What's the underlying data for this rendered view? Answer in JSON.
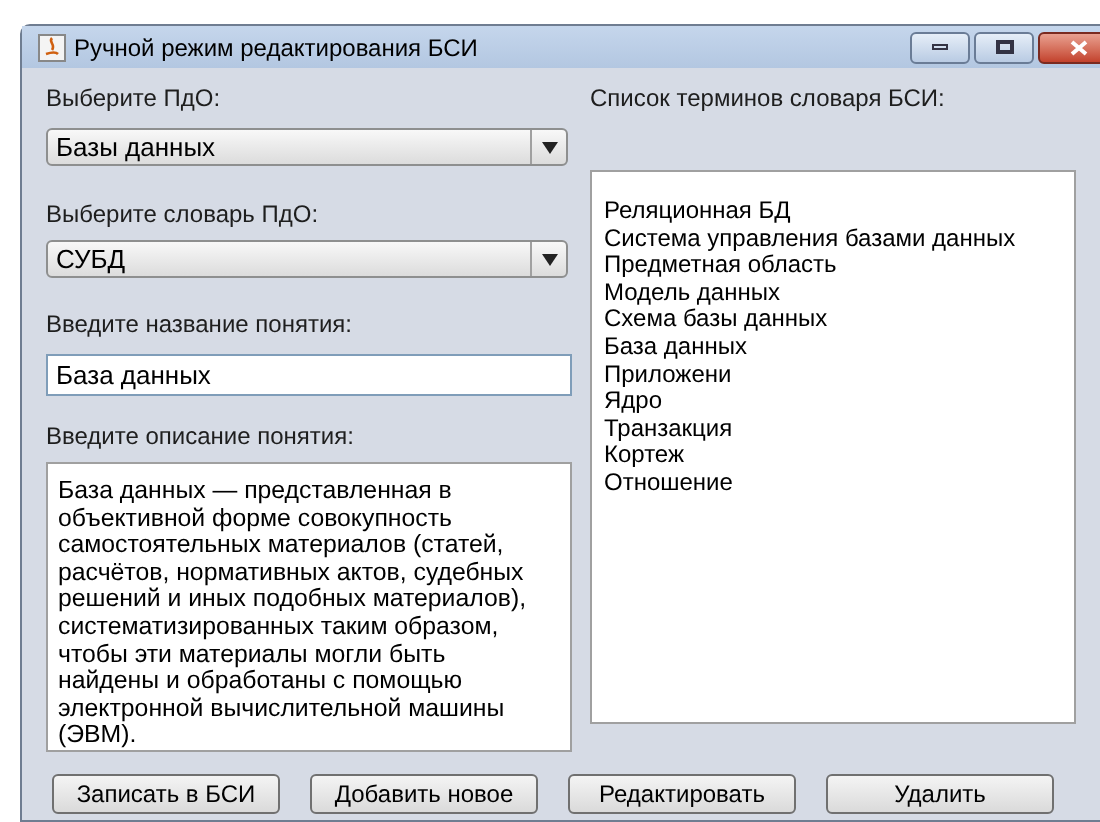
{
  "window": {
    "title": "Ручной режим редактирования БСИ"
  },
  "subject_area": {
    "label": "Выберите ПдО:",
    "value": "Базы данных"
  },
  "dictionary": {
    "label": "Выберите словарь ПдО:",
    "value": "СУБД"
  },
  "concept_name": {
    "label": "Введите название понятия:",
    "value": "База данных"
  },
  "concept_description": {
    "label": "Введите описание понятия:",
    "value": "База данных — представленная в объективной форме совокупность самостоятельных материалов (статей, расчётов, нормативных актов, судебных решений и иных подобных материалов), систематизированных таким образом, чтобы эти материалы могли быть найдены и обработаны с помощью электронной вычислительной машины (ЭВМ)."
  },
  "terms": {
    "label": "Список терминов словаря БСИ:",
    "items": [
      "Реляционная БД",
      "Система управления базами данных",
      "Предметная область",
      "Модель данных",
      "Схема базы данных",
      "База данных",
      "Приложени",
      "Ядро",
      "Транзакция",
      "Кортеж",
      "Отношение"
    ]
  },
  "buttons": [
    "Записать в БСИ",
    "Добавить новое",
    "Редактировать",
    "Удалить"
  ]
}
